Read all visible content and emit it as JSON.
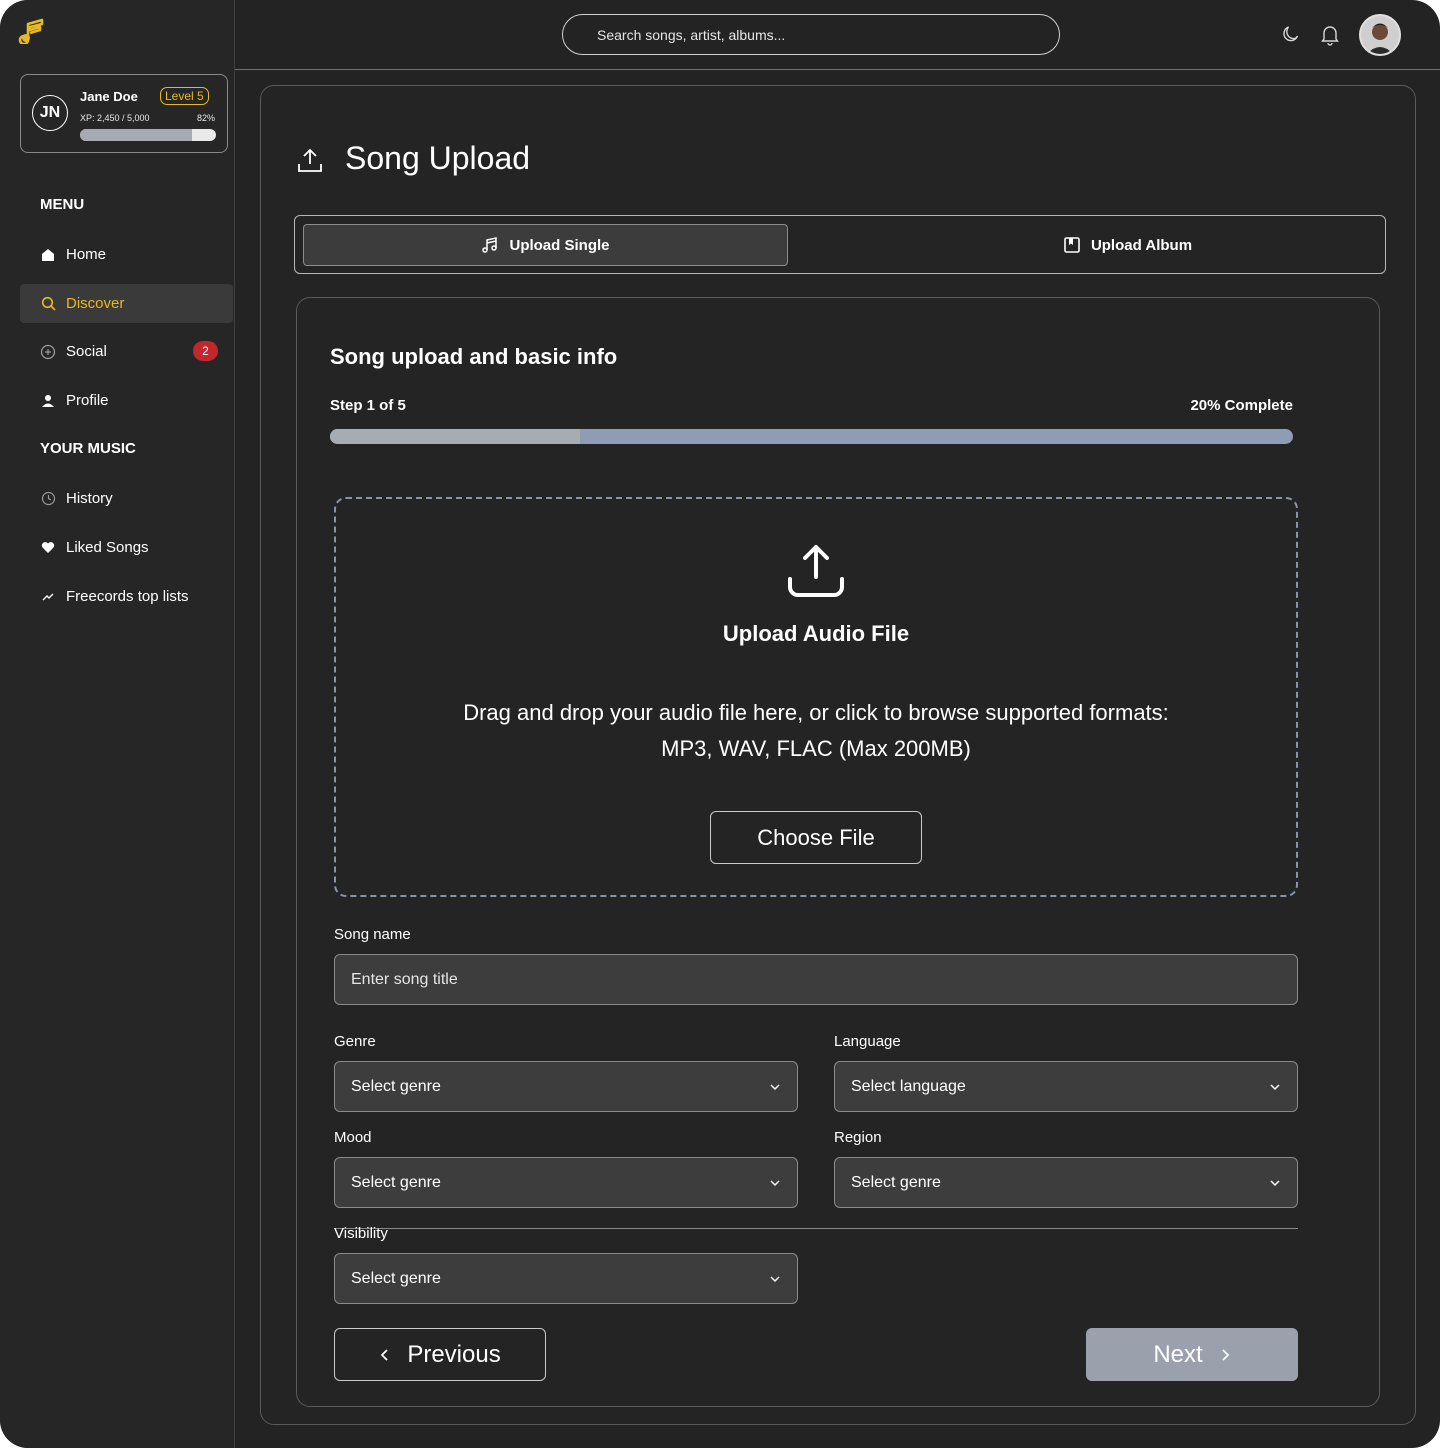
{
  "sidebar": {
    "user": {
      "initials": "JN",
      "name": "Jane Doe",
      "level": "Level 5",
      "xp_text": "XP: 2,450 / 5,000",
      "xp_percent_label": "82%",
      "xp_progress": 0.82
    },
    "menu_title": "MENU",
    "menu_items": [
      {
        "label": "Home",
        "icon": "home-icon"
      },
      {
        "label": "Discover",
        "icon": "search-icon",
        "active": true
      },
      {
        "label": "Social",
        "icon": "chat-plus-icon",
        "badge": "2"
      },
      {
        "label": "Profile",
        "icon": "user-icon"
      }
    ],
    "music_title": "YOUR MUSIC",
    "music_items": [
      {
        "label": "History",
        "icon": "history-icon"
      },
      {
        "label": "Liked Songs",
        "icon": "heart-icon"
      },
      {
        "label": "Freecords top lists",
        "icon": "trending-icon"
      }
    ]
  },
  "topbar": {
    "search_placeholder": "Search songs, artist, albums...",
    "icons": [
      "moon-icon",
      "bell-icon",
      "avatar"
    ]
  },
  "page": {
    "title": "Song Upload",
    "tabs": [
      {
        "label": "Upload Single",
        "icon": "music-note-icon",
        "active": true
      },
      {
        "label": "Upload Album",
        "icon": "album-icon",
        "active": false
      }
    ]
  },
  "form": {
    "title": "Song upload and basic info",
    "step": "Step 1 of 5",
    "complete": "20% Complete",
    "progress": 0.26,
    "dropzone": {
      "title": "Upload Audio File",
      "description": "Drag and drop your audio file here, or click to browse supported formats: MP3, WAV, FLAC (Max 200MB)",
      "button": "Choose File"
    },
    "fields": {
      "song_name_label": "Song name",
      "song_name_placeholder": "Enter song title",
      "genre_label": "Genre",
      "genre_value": "Select genre",
      "language_label": "Language",
      "language_value": "Select language",
      "mood_label": "Mood",
      "mood_value": "Select genre",
      "region_label": "Region",
      "region_value": "Select genre",
      "visibility_label": "Visibility",
      "visibility_value": "Select genre"
    },
    "prev_label": "Previous",
    "next_label": "Next"
  },
  "colors": {
    "background": "#232323",
    "accent": "#e7b923",
    "badge": "#c1272d",
    "progress_track": "#8e9db3",
    "next_button": "#9aa1ad"
  }
}
